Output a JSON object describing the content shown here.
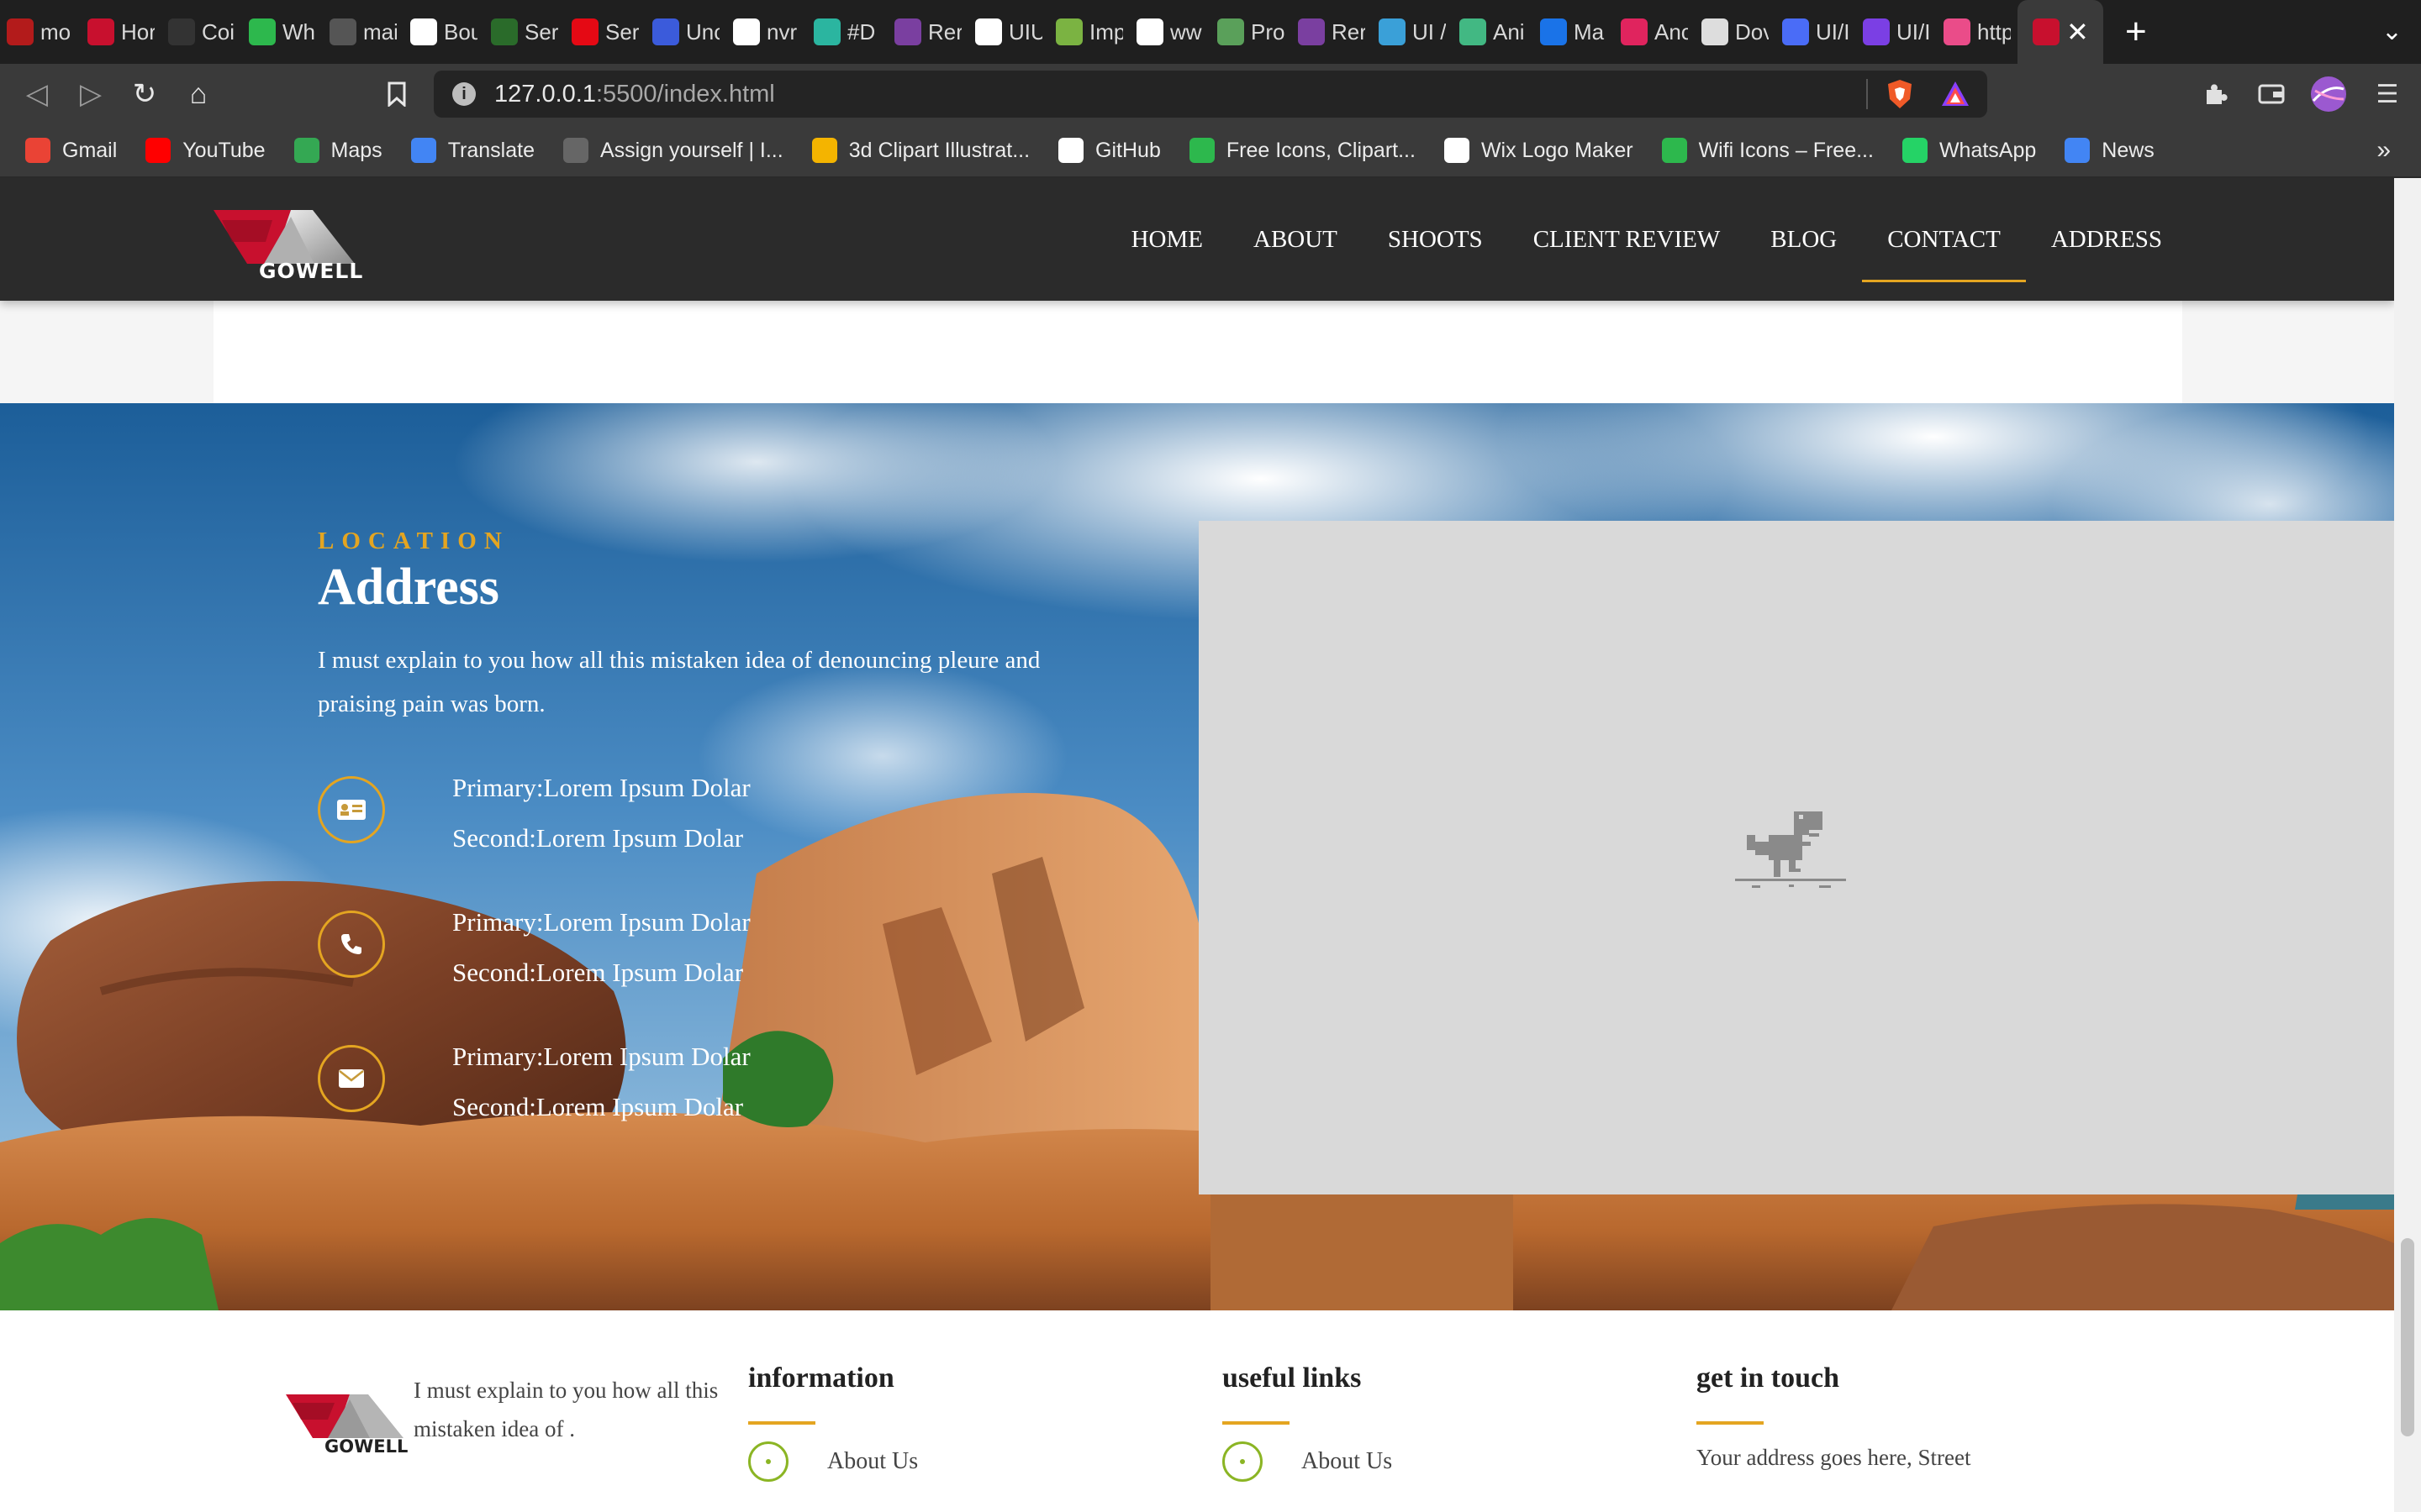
{
  "browser": {
    "tabs": [
      {
        "label": "mo",
        "icon": "search-engine-icon",
        "color": "#b31b1b"
      },
      {
        "label": "Hor",
        "icon": "chevron-logo-icon",
        "color": "#c8102e"
      },
      {
        "label": "Coi",
        "icon": "chart-icon",
        "color": "#333333"
      },
      {
        "label": "Wh",
        "icon": "whimsical-icon",
        "color": "#2db84d"
      },
      {
        "label": "mai",
        "icon": "gmail-icon",
        "color": "#555555"
      },
      {
        "label": "Bou",
        "icon": "r-logo-icon",
        "color": "#ffffff"
      },
      {
        "label": "Ser",
        "icon": "n-logo-icon",
        "color": "#2a6b2a"
      },
      {
        "label": "Ser",
        "icon": "netflix-icon",
        "color": "#e50914"
      },
      {
        "label": "Unc",
        "icon": "u-logo-icon",
        "color": "#3b5bdb"
      },
      {
        "label": "nvr",
        "icon": "google-icon",
        "color": "#ffffff"
      },
      {
        "label": "#D",
        "icon": "percent-icon",
        "color": "#2bb5a0"
      },
      {
        "label": "Rer",
        "icon": "blob-icon",
        "color": "#7a3fa0"
      },
      {
        "label": "UIU",
        "icon": "circle-logo-icon",
        "color": "#ffffff"
      },
      {
        "label": "Imp",
        "icon": "dat-icon",
        "color": "#7bb342"
      },
      {
        "label": "ww",
        "icon": "google-icon",
        "color": "#ffffff"
      },
      {
        "label": "Pro",
        "icon": "document-icon",
        "color": "#5aa05a"
      },
      {
        "label": "Rer",
        "icon": "blob-icon",
        "color": "#7a3fa0"
      },
      {
        "label": "UI /",
        "icon": "cloud-icon",
        "color": "#3aa0d8"
      },
      {
        "label": "Ani",
        "icon": "vue-icon",
        "color": "#42b883"
      },
      {
        "label": "Ma",
        "icon": "menu-icon",
        "color": "#1a73e8"
      },
      {
        "label": "Anc",
        "icon": "pattern-icon",
        "color": "#e0245e"
      },
      {
        "label": "Dov",
        "icon": "download-icon",
        "color": "#dddddd"
      },
      {
        "label": "UI/I",
        "icon": "bookmark-blue-icon",
        "color": "#4a6cf7"
      },
      {
        "label": "UI/I",
        "icon": "sparkle-icon",
        "color": "#7b3fe4"
      },
      {
        "label": "http",
        "icon": "dribbble-icon",
        "color": "#ea4c89"
      },
      {
        "label": "",
        "icon": "gowell-tab-icon",
        "color": "#c8102e",
        "active": true
      }
    ],
    "url_host": "127.0.0.1",
    "url_path": ":5500/index.html",
    "bookmarks": [
      {
        "label": "Gmail",
        "icon": "gmail-icon",
        "color": "#ea4335"
      },
      {
        "label": "YouTube",
        "icon": "youtube-icon",
        "color": "#ff0000"
      },
      {
        "label": "Maps",
        "icon": "maps-icon",
        "color": "#34a853"
      },
      {
        "label": "Translate",
        "icon": "translate-icon",
        "color": "#4285f4"
      },
      {
        "label": "Assign yourself | I...",
        "icon": "robot-icon",
        "color": "#666666"
      },
      {
        "label": "3d Clipart Illustrat...",
        "icon": "o-logo-icon",
        "color": "#f4b400"
      },
      {
        "label": "GitHub",
        "icon": "github-icon",
        "color": "#ffffff"
      },
      {
        "label": "Free Icons, Clipart...",
        "icon": "flaticon-icon",
        "color": "#2db84d"
      },
      {
        "label": "Wix Logo Maker",
        "icon": "wix-icon",
        "color": "#ffffff"
      },
      {
        "label": "Wifi Icons – Free...",
        "icon": "flaticon-icon",
        "color": "#2db84d"
      },
      {
        "label": "WhatsApp",
        "icon": "whatsapp-icon",
        "color": "#25d366"
      },
      {
        "label": "News",
        "icon": "news-icon",
        "color": "#4285f4"
      }
    ],
    "more_bookmarks": "»"
  },
  "site": {
    "logo_text": "GOWELL",
    "nav": [
      {
        "label": "HOME"
      },
      {
        "label": "ABOUT"
      },
      {
        "label": "SHOOTS"
      },
      {
        "label": "CLIENT REVIEW"
      },
      {
        "label": "BLOG"
      },
      {
        "label": "CONTACT",
        "active": true
      },
      {
        "label": "ADDRESS"
      }
    ],
    "accent": "#e4a521"
  },
  "location": {
    "kicker": "LOCATION",
    "title": "Address",
    "description": "I must explain to you how all this mistaken idea of denouncing pleure and praising pain was born.",
    "items": [
      {
        "icon": "id-card-icon",
        "primary": "Primary:Lorem Ipsum Dolar",
        "second": "Second:Lorem Ipsum Dolar"
      },
      {
        "icon": "phone-icon",
        "primary": "Primary:Lorem Ipsum Dolar",
        "second": "Second:Lorem Ipsum Dolar"
      },
      {
        "icon": "envelope-icon",
        "primary": "Primary:Lorem Ipsum Dolar",
        "second": "Second:Lorem Ipsum Dolar"
      }
    ]
  },
  "map": {
    "placeholder_icon": "offline-dino-icon"
  },
  "footer": {
    "logo_text": "GOWELL",
    "about": "I must explain to you how all this mistaken idea of .",
    "columns": [
      {
        "heading": "information",
        "first_link": "About Us"
      },
      {
        "heading": "useful links",
        "first_link": "About Us"
      },
      {
        "heading": "get in touch",
        "address": "Your address goes here, Street"
      }
    ]
  }
}
